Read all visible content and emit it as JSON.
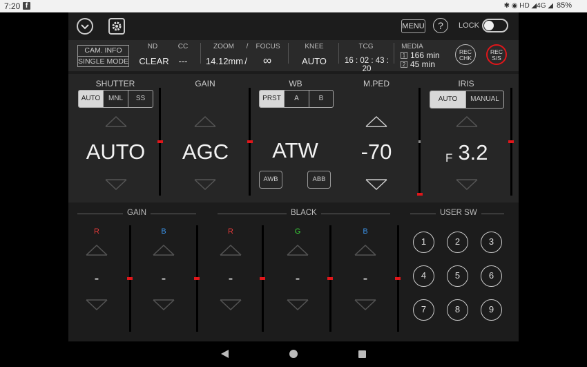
{
  "status": {
    "time": "7:20",
    "fb": "f",
    "icons": "✱ ◉ HD ◢4G ◢",
    "battery": "85%"
  },
  "top": {
    "menu_label": "MENU",
    "help_label": "?",
    "lock_label": "LOCK"
  },
  "info": {
    "cam_info": "CAM. INFO",
    "single_mode": "SINGLE MODE",
    "nd_label": "ND",
    "nd_value": "CLEAR",
    "cc_label": "CC",
    "cc_value": "---",
    "zoom_label": "ZOOM",
    "zoom_value": "14.12mm",
    "slash": "/",
    "focus_label": "FOCUS",
    "focus_value": "∞",
    "knee_label": "KNEE",
    "knee_value": "AUTO",
    "tcg_label": "TCG",
    "tcg_value": "16 : 02 : 43 : 20",
    "media_label": "MEDIA",
    "media1_slot": "1",
    "media1_value": "166 min",
    "media2_slot": "2",
    "media2_value": "45 min",
    "rec_chk": [
      "REC",
      "CHK"
    ],
    "rec_ss": [
      "REC",
      "S/S"
    ]
  },
  "shutter": {
    "title": "SHUTTER",
    "modes": [
      "AUTO",
      "MNL",
      "SS"
    ],
    "value": "AUTO"
  },
  "gain": {
    "title": "GAIN",
    "value": "AGC"
  },
  "wb": {
    "title": "WB",
    "modes": [
      "PRST",
      "A",
      "B"
    ],
    "value": "ATW",
    "awb": "AWB",
    "abb": "ABB"
  },
  "mped": {
    "title": "M.PED",
    "value": "-70"
  },
  "iris": {
    "title": "IRIS",
    "modes": [
      "AUTO",
      "MANUAL"
    ],
    "f_label": "F",
    "value": "3.2"
  },
  "lower": {
    "gain_title": "GAIN",
    "black_title": "BLACK",
    "usersw_title": "USER SW",
    "channels": [
      {
        "label": "R",
        "color": "#e23a3a",
        "value": "-"
      },
      {
        "label": "B",
        "color": "#3a8fe2",
        "value": "-"
      },
      {
        "label": "R",
        "color": "#e23a3a",
        "value": "-"
      },
      {
        "label": "G",
        "color": "#3ad03a",
        "value": "-"
      },
      {
        "label": "B",
        "color": "#3a8fe2",
        "value": "-"
      }
    ],
    "user_sw": [
      "1",
      "2",
      "3",
      "4",
      "5",
      "6",
      "7",
      "8",
      "9"
    ]
  }
}
